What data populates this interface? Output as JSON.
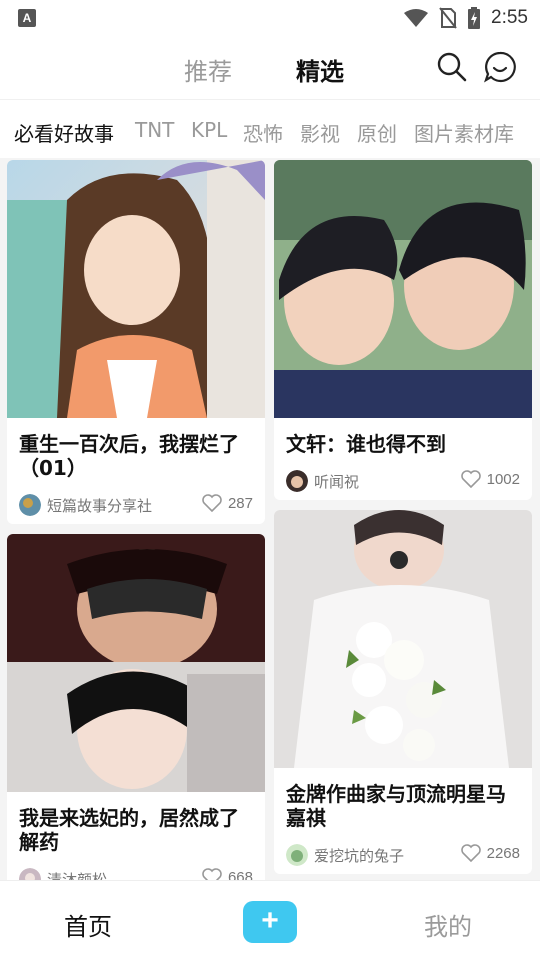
{
  "status_bar": {
    "app_icon_letter": "A",
    "time": "2:55",
    "icons": [
      "wifi-icon",
      "no-sim-icon",
      "battery-charging-icon"
    ]
  },
  "header": {
    "tabs": [
      {
        "label": "推荐",
        "active": false
      },
      {
        "label": "精选",
        "active": true
      }
    ],
    "icons": [
      "search-icon",
      "message-icon"
    ]
  },
  "categories": [
    {
      "label": "必看好故事",
      "active": true
    },
    {
      "label": "TNT",
      "active": false
    },
    {
      "label": "KPL",
      "active": false
    },
    {
      "label": "恐怖",
      "active": false
    },
    {
      "label": "影视",
      "active": false
    },
    {
      "label": "原创",
      "active": false
    },
    {
      "label": "图片素材库",
      "active": false
    }
  ],
  "cards": [
    {
      "title": "重生一百次后，我摆烂了（01）",
      "author": "短篇故事分享社",
      "likes": "287"
    },
    {
      "title": "文轩：谁也得不到",
      "author": "听闻祝",
      "likes": "1002"
    },
    {
      "title": "我是来选妃的，居然成了解药",
      "author": "清沐颜松",
      "likes": "668"
    },
    {
      "title": "金牌作曲家与顶流明星马嘉祺",
      "author": "爱挖坑的兔子",
      "likes": "2268"
    }
  ],
  "bottom_nav": {
    "home": "首页",
    "add": "+",
    "mine": "我的"
  },
  "colors": {
    "accent": "#3fc8f0",
    "text_primary": "#111111",
    "text_secondary": "#9a9a9a",
    "feed_background": "#f4f4f4"
  }
}
